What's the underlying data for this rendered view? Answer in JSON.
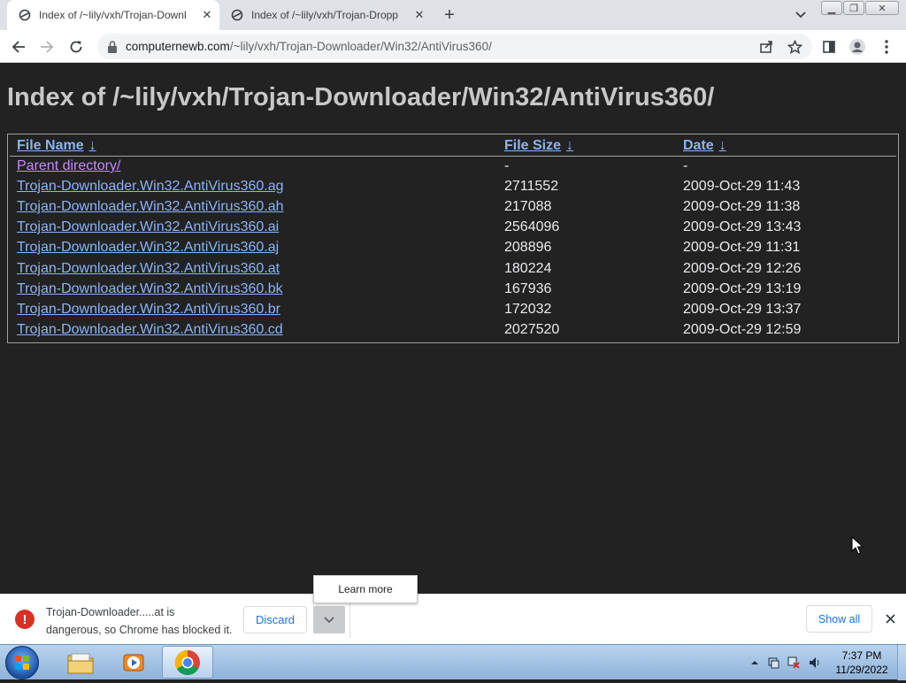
{
  "browser": {
    "tabs": [
      {
        "title": "Index of /~lily/vxh/Trojan-Downl",
        "active": true
      },
      {
        "title": "Index of /~lily/vxh/Trojan-Dropp",
        "active": false
      }
    ],
    "new_tab_label": "+",
    "url_host": "computernewb.com",
    "url_path": "/~lily/vxh/Trojan-Downloader/Win32/AntiVirus360/"
  },
  "page": {
    "heading": "Index of /~lily/vxh/Trojan-Downloader/Win32/AntiVirus360/",
    "columns": {
      "name": "File Name",
      "size": "File Size",
      "date": "Date",
      "sort_arrow": "↓"
    },
    "parent": {
      "name": "Parent directory/",
      "size": "-",
      "date": "-"
    },
    "files": [
      {
        "name": "Trojan-Downloader.Win32.AntiVirus360.ag",
        "size": "2711552",
        "date": "2009-Oct-29 11:43"
      },
      {
        "name": "Trojan-Downloader.Win32.AntiVirus360.ah",
        "size": "217088",
        "date": "2009-Oct-29 11:38"
      },
      {
        "name": "Trojan-Downloader.Win32.AntiVirus360.ai",
        "size": "2564096",
        "date": "2009-Oct-29 13:43"
      },
      {
        "name": "Trojan-Downloader.Win32.AntiVirus360.aj",
        "size": "208896",
        "date": "2009-Oct-29 11:31"
      },
      {
        "name": "Trojan-Downloader.Win32.AntiVirus360.at",
        "size": "180224",
        "date": "2009-Oct-29 12:26"
      },
      {
        "name": "Trojan-Downloader.Win32.AntiVirus360.bk",
        "size": "167936",
        "date": "2009-Oct-29 13:19"
      },
      {
        "name": "Trojan-Downloader.Win32.AntiVirus360.br",
        "size": "172032",
        "date": "2009-Oct-29 13:37"
      },
      {
        "name": "Trojan-Downloader.Win32.AntiVirus360.cd",
        "size": "2027520",
        "date": "2009-Oct-29 12:59"
      }
    ]
  },
  "downloads": {
    "message_line1": "Trojan-Downloader.....at is",
    "message_line2": "dangerous, so Chrome has blocked it.",
    "discard_label": "Discard",
    "learn_more_label": "Learn more",
    "show_all_label": "Show all",
    "warning_glyph": "!"
  },
  "taskbar": {
    "time": "7:37 PM",
    "date": "11/29/2022"
  },
  "colors": {
    "page_bg": "#222222",
    "link": "#8ab4f8",
    "visited_link": "#c58af9",
    "heading": "#c8c8c8",
    "danger": "#d93025",
    "accent": "#1a73e8"
  }
}
